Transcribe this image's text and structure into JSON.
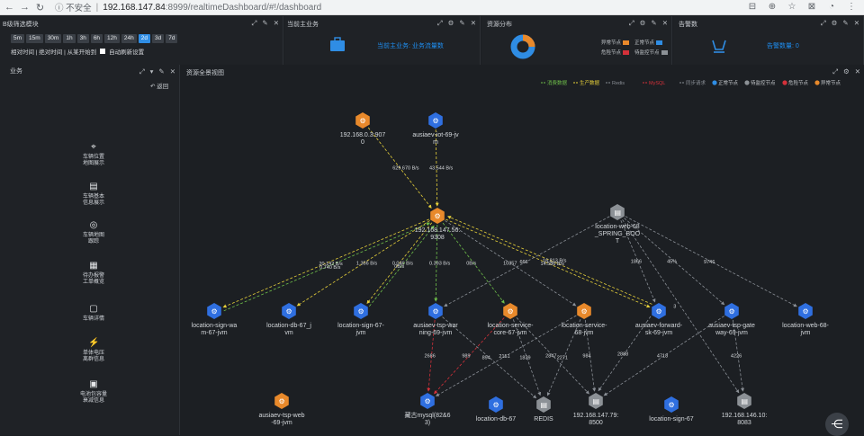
{
  "browser": {
    "security": "不安全",
    "host": "192.168.147.84",
    "path": ":8999/realtimeDashboard/#!/dashboard"
  },
  "time_panel": {
    "title": "B级筛选模块",
    "buttons": [
      "5m",
      "15m",
      "30m",
      "1h",
      "3h",
      "6h",
      "12h",
      "24h",
      "2d",
      "3d",
      "7d"
    ],
    "active": "2d",
    "aux": "相对时间 | 绝对时间 | 从某开始到",
    "auto_refresh": "自动刷新设置"
  },
  "biz_panel": {
    "title": "当前主业务",
    "text": "当前主业务: 业务流量数"
  },
  "res_panel": {
    "title": "资源分布",
    "legend": [
      {
        "label": "异常节点",
        "color": "#e8892b"
      },
      {
        "label": "正常节点",
        "color": "#2f8de4"
      },
      {
        "label": "危险节点",
        "color": "#d4313a"
      },
      {
        "label": "待监控节点",
        "color": "#8c9196"
      }
    ],
    "donut": [
      {
        "v": 0.22,
        "color": "#e8892b"
      },
      {
        "v": 0.78,
        "color": "#2f8de4"
      }
    ]
  },
  "alarm_panel": {
    "title": "告警数",
    "text": "告警数量: 0"
  },
  "side": {
    "title": "业务",
    "back": "返回",
    "items": [
      {
        "label": "车辆位置\n地图展示",
        "icon": "location-icon",
        "glyph": "⌖"
      },
      {
        "label": "车辆基本\n信息展示",
        "icon": "list-icon",
        "glyph": "▤"
      },
      {
        "label": "车辆地图\n跟踪",
        "icon": "track-icon",
        "glyph": "◎"
      },
      {
        "label": "待办报警\n工单概览",
        "icon": "report-icon",
        "glyph": "▦"
      },
      {
        "label": "车辆详情",
        "icon": "detail-icon",
        "glyph": "▢"
      },
      {
        "label": "单体电压\n离群信息",
        "icon": "voltage-icon",
        "glyph": "⚡"
      },
      {
        "label": "电池包容量\n衰减信息",
        "icon": "battery-icon",
        "glyph": "▣"
      }
    ]
  },
  "graph": {
    "title": "资源全景视图",
    "legend_edges": [
      {
        "label": "消费数据",
        "color": "#6fbf4a"
      },
      {
        "label": "生产数据",
        "color": "#e6d03a"
      },
      {
        "label": "Redis",
        "color": "#8a8f96"
      },
      {
        "label": "MySQL",
        "color": "#d4313a"
      },
      {
        "label": "同步请求",
        "color": "#8a8f96"
      }
    ],
    "legend_nodes": [
      {
        "label": "正常节点",
        "color": "#2f8de4"
      },
      {
        "label": "待监控节点",
        "color": "#8c9196"
      },
      {
        "label": "危险节点",
        "color": "#d4313a"
      },
      {
        "label": "异常节点",
        "color": "#e8892b"
      }
    ],
    "nodes": [
      {
        "id": "n1",
        "label": [
          "192.168.0.3:907",
          "0"
        ],
        "type": "orange"
      },
      {
        "id": "n2",
        "label": [
          "ausiaev-iot-69-jv",
          "m"
        ],
        "type": "blue"
      },
      {
        "id": "hub",
        "label": [
          "192.168.147.56:",
          "9308"
        ],
        "type": "orange"
      },
      {
        "id": "user",
        "label": [
          "location-web-68",
          "_SPRING_BOO",
          "T"
        ],
        "type": "grey"
      },
      {
        "id": "b1",
        "label": [
          "location-sign-wa",
          "m-67-jvm"
        ],
        "type": "blue"
      },
      {
        "id": "b2",
        "label": [
          "location-db-67_j",
          "vm"
        ],
        "type": "blue"
      },
      {
        "id": "b3",
        "label": [
          "location-sign-67-",
          "jvm"
        ],
        "type": "blue"
      },
      {
        "id": "b4",
        "label": [
          "ausiaev-tsp-war",
          "ning-69-jvm"
        ],
        "type": "blue"
      },
      {
        "id": "b5",
        "label": [
          "location-service-",
          "core-67-jvm"
        ],
        "type": "orange"
      },
      {
        "id": "b6",
        "label": [
          "location-service-",
          "68-jvm"
        ],
        "type": "orange"
      },
      {
        "id": "b7",
        "label": [
          "ausiaev-forward-",
          "sk-69-jvm"
        ],
        "type": "blue"
      },
      {
        "id": "b8",
        "label": [
          "ausiaev-tsp-gate",
          "way-69-jvm"
        ],
        "type": "blue"
      },
      {
        "id": "b9",
        "label": [
          "location-web-68-",
          "jvm"
        ],
        "type": "blue"
      },
      {
        "id": "c0",
        "label": [
          "ausiaev-tsp-web",
          "-69-jvm"
        ],
        "type": "orange"
      },
      {
        "id": "c1",
        "label": [
          "藏古mysql(82&6",
          "3)"
        ],
        "type": "blue"
      },
      {
        "id": "c2",
        "label": [
          "location-db-67"
        ],
        "type": "blue"
      },
      {
        "id": "c3",
        "label": [
          "REDIS"
        ],
        "type": "grey"
      },
      {
        "id": "c4",
        "label": [
          "192.168.147.79:",
          "8500"
        ],
        "type": "grey"
      },
      {
        "id": "c5",
        "label": [
          "location-sign-67"
        ],
        "type": "blue"
      },
      {
        "id": "c6",
        "label": [
          "192.168.146.10:",
          "8083"
        ],
        "type": "grey"
      }
    ],
    "edges": [
      {
        "from": "n1",
        "to": "hub",
        "label": "629.670 B/s",
        "color": "#e6d03a"
      },
      {
        "from": "n2",
        "to": "hub",
        "label": "43.544 B/s",
        "color": "#e6d03a"
      },
      {
        "from": "hub",
        "to": "b1",
        "label": "20.142 B/s",
        "color": "#e6d03a"
      },
      {
        "from": "b1",
        "to": "hub",
        "label": "0.740 B/s",
        "color": "#6fbf4a"
      },
      {
        "from": "hub",
        "to": "b2",
        "label": "1.356 B/s",
        "color": "#e6d03a"
      },
      {
        "from": "hub",
        "to": "b3",
        "label": "0.046 B/s",
        "color": "#e6d03a"
      },
      {
        "from": "b3",
        "to": "hub",
        "label": "0B/s",
        "color": "#6fbf4a"
      },
      {
        "from": "hub",
        "to": "b4",
        "label": "0.393 B/s",
        "color": "#6fbf4a"
      },
      {
        "from": "hub",
        "to": "b5",
        "label": "0B/s",
        "color": "#6fbf4a"
      },
      {
        "from": "hub",
        "to": "b6",
        "label": "10357",
        "color": "#8a8f96"
      },
      {
        "from": "hub",
        "to": "b7",
        "label": "14.586 B/s",
        "color": "#e6d03a"
      },
      {
        "from": "b7",
        "to": "hub",
        "label": "16.813 B/s",
        "color": "#e6d03a"
      },
      {
        "from": "user",
        "to": "b4",
        "label": "666",
        "color": "#8a8f96"
      },
      {
        "from": "user",
        "to": "b7",
        "label": "1866",
        "color": "#8a8f96"
      },
      {
        "from": "user",
        "to": "b8",
        "label": "45%",
        "color": "#8a8f96"
      },
      {
        "from": "user",
        "to": "b9",
        "label": "9746",
        "color": "#8a8f96"
      },
      {
        "from": "user",
        "to": "c6",
        "label": "3",
        "color": "#8a8f96"
      },
      {
        "from": "b4",
        "to": "c1",
        "label": "2686",
        "color": "#d4313a"
      },
      {
        "from": "b5",
        "to": "c1",
        "label": "989",
        "color": "#d4313a"
      },
      {
        "from": "b4",
        "to": "c3",
        "label": "894",
        "color": "#8a8f96"
      },
      {
        "from": "b5",
        "to": "c3",
        "label": "1839",
        "color": "#8a8f96"
      },
      {
        "from": "b5",
        "to": "c4",
        "label": "2847",
        "color": "#8a8f96"
      },
      {
        "from": "b6",
        "to": "c3",
        "label": "2271",
        "color": "#8a8f96"
      },
      {
        "from": "b6",
        "to": "c4",
        "label": "984",
        "color": "#8a8f96"
      },
      {
        "from": "b7",
        "to": "c4",
        "label": "2888",
        "color": "#8a8f96"
      },
      {
        "from": "b8",
        "to": "c4",
        "label": "4718",
        "color": "#8a8f96"
      },
      {
        "from": "b8",
        "to": "c6",
        "label": "4226",
        "color": "#8a8f96"
      },
      {
        "from": "b6",
        "to": "c1",
        "label": "2151",
        "color": "#8a8f96"
      }
    ]
  }
}
